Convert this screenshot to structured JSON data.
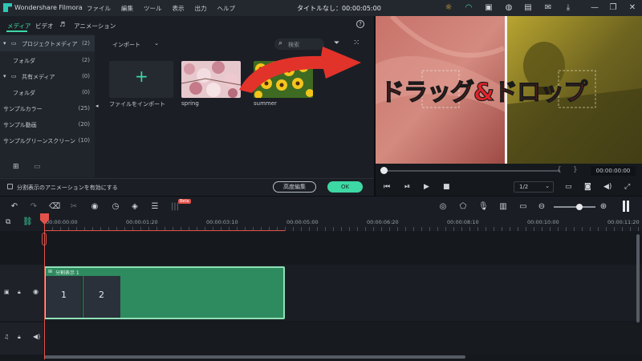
{
  "app": {
    "title": "Wondershare Filmora",
    "menu": [
      "ファイル",
      "編集",
      "ツール",
      "表示",
      "出力",
      "ヘルプ"
    ],
    "doc_title": "タイトルなし：00:00:05:00"
  },
  "media": {
    "tabs": [
      "メディア",
      "ビデオ",
      "",
      "アニメーション"
    ],
    "active_tab": "メディア",
    "import_dropdown": "インポート",
    "search_placeholder": "検索",
    "nav": [
      {
        "label": "プロジェクトメディア",
        "count": "(2)"
      },
      {
        "label": "フォルダ",
        "count": "(2)"
      },
      {
        "label": "共有メディア",
        "count": "(0)"
      },
      {
        "label": "フォルダ",
        "count": "(0)"
      },
      {
        "label": "サンプルカラー",
        "count": "(25)"
      },
      {
        "label": "サンプル動画",
        "count": "(20)"
      },
      {
        "label": "サンプルグリーンスクリーン",
        "count": "(10)"
      }
    ],
    "import_tile_label": "ファイルをインポート",
    "thumbs": [
      "spring",
      "summer"
    ],
    "split_checkbox_label": "分割表示のアニメーションを有効にする",
    "advanced_button": "高度編集",
    "ok_button": "OK"
  },
  "preview": {
    "overlay_text": "ドラッグ&ドロップ",
    "timecode": "00:00:00:00",
    "quality": "1/2",
    "colors": {
      "overlay_fill": "#e2232a",
      "arrow": "#e2332b"
    }
  },
  "timeline": {
    "new_badge": "Beta",
    "ruler_labels": [
      "00:00:00:00",
      "00:00:01:20",
      "00:00:03:10",
      "00:00:05:00",
      "00:00:06:20",
      "00:00:08:10",
      "00:00:10:00",
      "00:00:11:20"
    ],
    "clip_title": "分割表示 1",
    "clip_cells": [
      "1",
      "2"
    ],
    "colors": {
      "clip": "#2e8b5f",
      "clip_border": "#8fe0b6",
      "playhead": "#e3524a",
      "accent": "#3ed8a5"
    }
  }
}
